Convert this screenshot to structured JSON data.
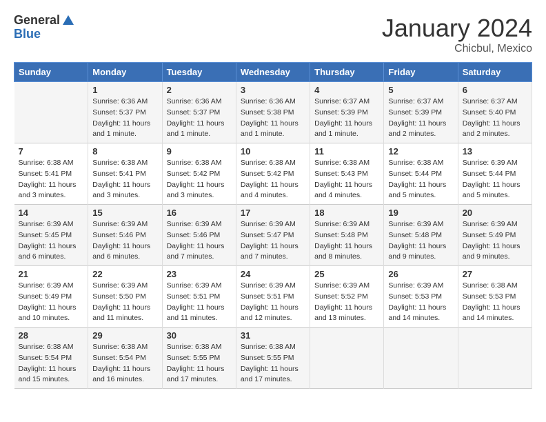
{
  "header": {
    "logo_general": "General",
    "logo_blue": "Blue",
    "month_title": "January 2024",
    "location": "Chicbul, Mexico"
  },
  "days_of_week": [
    "Sunday",
    "Monday",
    "Tuesday",
    "Wednesday",
    "Thursday",
    "Friday",
    "Saturday"
  ],
  "weeks": [
    [
      {
        "num": "",
        "detail": ""
      },
      {
        "num": "1",
        "detail": "Sunrise: 6:36 AM\nSunset: 5:37 PM\nDaylight: 11 hours and 1 minute."
      },
      {
        "num": "2",
        "detail": "Sunrise: 6:36 AM\nSunset: 5:37 PM\nDaylight: 11 hours and 1 minute."
      },
      {
        "num": "3",
        "detail": "Sunrise: 6:36 AM\nSunset: 5:38 PM\nDaylight: 11 hours and 1 minute."
      },
      {
        "num": "4",
        "detail": "Sunrise: 6:37 AM\nSunset: 5:39 PM\nDaylight: 11 hours and 1 minute."
      },
      {
        "num": "5",
        "detail": "Sunrise: 6:37 AM\nSunset: 5:39 PM\nDaylight: 11 hours and 2 minutes."
      },
      {
        "num": "6",
        "detail": "Sunrise: 6:37 AM\nSunset: 5:40 PM\nDaylight: 11 hours and 2 minutes."
      }
    ],
    [
      {
        "num": "7",
        "detail": "Sunrise: 6:38 AM\nSunset: 5:41 PM\nDaylight: 11 hours and 3 minutes."
      },
      {
        "num": "8",
        "detail": "Sunrise: 6:38 AM\nSunset: 5:41 PM\nDaylight: 11 hours and 3 minutes."
      },
      {
        "num": "9",
        "detail": "Sunrise: 6:38 AM\nSunset: 5:42 PM\nDaylight: 11 hours and 3 minutes."
      },
      {
        "num": "10",
        "detail": "Sunrise: 6:38 AM\nSunset: 5:42 PM\nDaylight: 11 hours and 4 minutes."
      },
      {
        "num": "11",
        "detail": "Sunrise: 6:38 AM\nSunset: 5:43 PM\nDaylight: 11 hours and 4 minutes."
      },
      {
        "num": "12",
        "detail": "Sunrise: 6:38 AM\nSunset: 5:44 PM\nDaylight: 11 hours and 5 minutes."
      },
      {
        "num": "13",
        "detail": "Sunrise: 6:39 AM\nSunset: 5:44 PM\nDaylight: 11 hours and 5 minutes."
      }
    ],
    [
      {
        "num": "14",
        "detail": "Sunrise: 6:39 AM\nSunset: 5:45 PM\nDaylight: 11 hours and 6 minutes."
      },
      {
        "num": "15",
        "detail": "Sunrise: 6:39 AM\nSunset: 5:46 PM\nDaylight: 11 hours and 6 minutes."
      },
      {
        "num": "16",
        "detail": "Sunrise: 6:39 AM\nSunset: 5:46 PM\nDaylight: 11 hours and 7 minutes."
      },
      {
        "num": "17",
        "detail": "Sunrise: 6:39 AM\nSunset: 5:47 PM\nDaylight: 11 hours and 7 minutes."
      },
      {
        "num": "18",
        "detail": "Sunrise: 6:39 AM\nSunset: 5:48 PM\nDaylight: 11 hours and 8 minutes."
      },
      {
        "num": "19",
        "detail": "Sunrise: 6:39 AM\nSunset: 5:48 PM\nDaylight: 11 hours and 9 minutes."
      },
      {
        "num": "20",
        "detail": "Sunrise: 6:39 AM\nSunset: 5:49 PM\nDaylight: 11 hours and 9 minutes."
      }
    ],
    [
      {
        "num": "21",
        "detail": "Sunrise: 6:39 AM\nSunset: 5:49 PM\nDaylight: 11 hours and 10 minutes."
      },
      {
        "num": "22",
        "detail": "Sunrise: 6:39 AM\nSunset: 5:50 PM\nDaylight: 11 hours and 11 minutes."
      },
      {
        "num": "23",
        "detail": "Sunrise: 6:39 AM\nSunset: 5:51 PM\nDaylight: 11 hours and 11 minutes."
      },
      {
        "num": "24",
        "detail": "Sunrise: 6:39 AM\nSunset: 5:51 PM\nDaylight: 11 hours and 12 minutes."
      },
      {
        "num": "25",
        "detail": "Sunrise: 6:39 AM\nSunset: 5:52 PM\nDaylight: 11 hours and 13 minutes."
      },
      {
        "num": "26",
        "detail": "Sunrise: 6:39 AM\nSunset: 5:53 PM\nDaylight: 11 hours and 14 minutes."
      },
      {
        "num": "27",
        "detail": "Sunrise: 6:38 AM\nSunset: 5:53 PM\nDaylight: 11 hours and 14 minutes."
      }
    ],
    [
      {
        "num": "28",
        "detail": "Sunrise: 6:38 AM\nSunset: 5:54 PM\nDaylight: 11 hours and 15 minutes."
      },
      {
        "num": "29",
        "detail": "Sunrise: 6:38 AM\nSunset: 5:54 PM\nDaylight: 11 hours and 16 minutes."
      },
      {
        "num": "30",
        "detail": "Sunrise: 6:38 AM\nSunset: 5:55 PM\nDaylight: 11 hours and 17 minutes."
      },
      {
        "num": "31",
        "detail": "Sunrise: 6:38 AM\nSunset: 5:55 PM\nDaylight: 11 hours and 17 minutes."
      },
      {
        "num": "",
        "detail": ""
      },
      {
        "num": "",
        "detail": ""
      },
      {
        "num": "",
        "detail": ""
      }
    ]
  ]
}
